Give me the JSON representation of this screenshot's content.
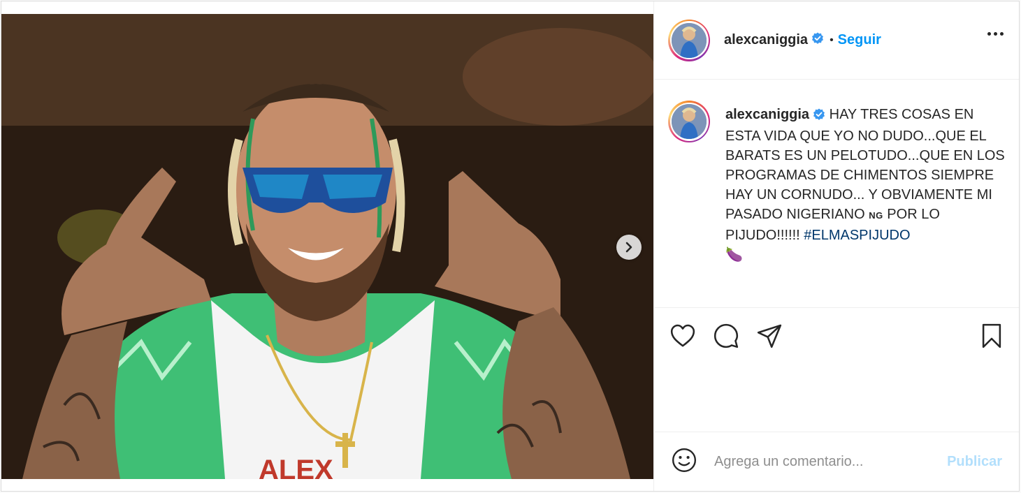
{
  "post": {
    "username": "alexcaniggia",
    "follow_label": "Seguir",
    "separator": "•",
    "caption": {
      "username": "alexcaniggia",
      "text": "HAY TRES COSAS EN ESTA VIDA QUE YO NO DUDO...QUE EL BARATS ES UN PELOTUDO...QUE EN LOS PROGRAMAS DE CHIMENTOS SIEMPRE HAY UN CORNUDO... Y OBVIAMENTE MI PASADO NIGERIANO",
      "flag": "NG",
      "text_after_flag": "POR LO PIJUDO!!!!!!",
      "hashtag": "#ELMASPIJUDO",
      "emoji": "🍆"
    },
    "photo_apron_text": "ALEX"
  },
  "comment": {
    "placeholder": "Agrega un comentario...",
    "publish_label": "Publicar"
  },
  "colors": {
    "link_blue": "#0095f6",
    "hashtag": "#00376b",
    "publish_disabled": "#b2dffc",
    "verified": "#3897f0"
  },
  "icons": {
    "like": "heart-icon",
    "comment": "comment-bubble-icon",
    "share": "paper-plane-icon",
    "save": "bookmark-icon",
    "emoji": "smiley-icon",
    "next": "chevron-right-icon",
    "more": "more-options-icon",
    "verified": "verified-badge-icon"
  }
}
